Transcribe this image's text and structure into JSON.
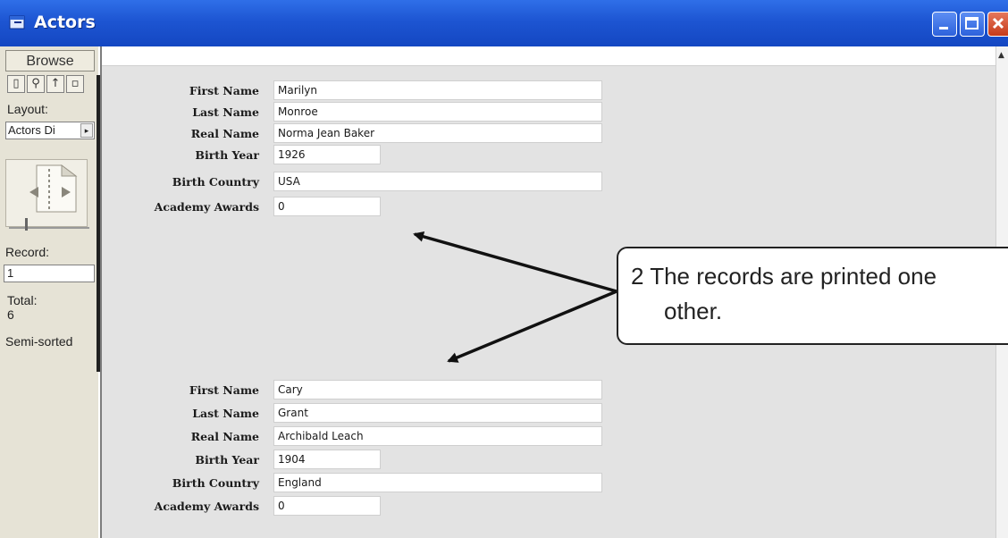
{
  "window": {
    "title": "Actors"
  },
  "status_area": {
    "tab_label": "Browse",
    "layout_label": "Layout:",
    "layout_value": "Actors Di",
    "record_label": "Record:",
    "record_value": "1",
    "total_label": "Total:",
    "total_value": "6",
    "sort_status": "Semi-sorted"
  },
  "records": [
    {
      "fields": [
        {
          "label": "First Name",
          "value": "Marilyn"
        },
        {
          "label": "Last Name",
          "value": "Monroe"
        },
        {
          "label": "Real Name",
          "value": "Norma Jean Baker"
        },
        {
          "label": "Birth Year",
          "value": "1926"
        },
        {
          "label": "Birth Country",
          "value": "USA"
        },
        {
          "label": "Academy Awards",
          "value": "0"
        }
      ]
    },
    {
      "fields": [
        {
          "label": "First Name",
          "value": "Cary"
        },
        {
          "label": "Last Name",
          "value": "Grant"
        },
        {
          "label": "Real Name",
          "value": "Archibald Leach"
        },
        {
          "label": "Birth Year",
          "value": "1904"
        },
        {
          "label": "Birth Country",
          "value": "England"
        },
        {
          "label": "Academy Awards",
          "value": "0"
        }
      ]
    }
  ],
  "callout": {
    "line1": "2 The records are printed one",
    "line2": "other."
  },
  "colors": {
    "titlebar": "#1d55d2",
    "content_bg": "#e3e3e3",
    "status_bg": "#e6e3d6",
    "close_button": "#c63b1a"
  }
}
